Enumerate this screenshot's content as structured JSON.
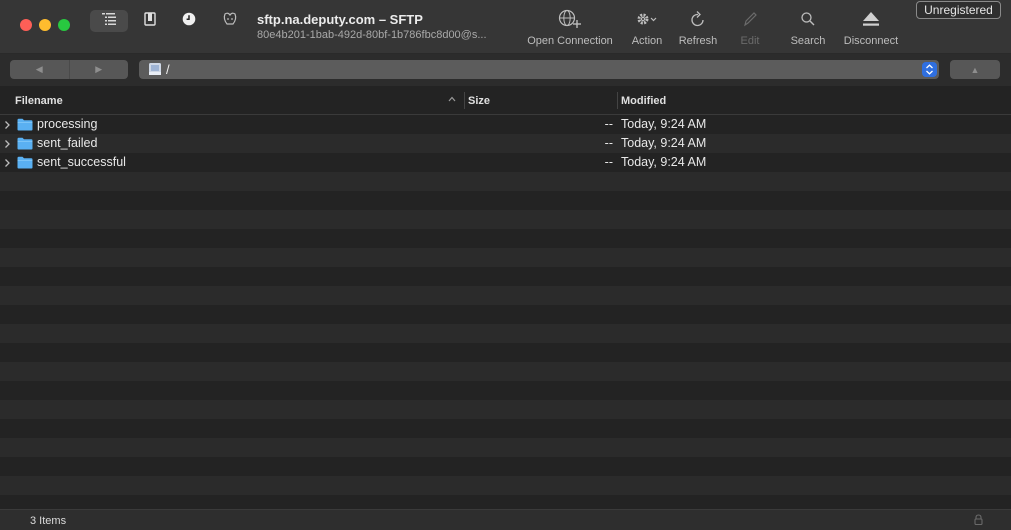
{
  "window": {
    "title": "sftp.na.deputy.com – SFTP",
    "subtitle": "80e4b201-1bab-492d-80bf-1b786fbc8d00@s..."
  },
  "toolbar": {
    "open_connection": "Open Connection",
    "action": "Action",
    "refresh": "Refresh",
    "edit": "Edit",
    "search": "Search",
    "disconnect": "Disconnect"
  },
  "badge": {
    "label": "Unregistered"
  },
  "path": {
    "value": "/"
  },
  "columns": {
    "filename": "Filename",
    "size": "Size",
    "modified": "Modified"
  },
  "files": [
    {
      "name": "processing",
      "size": "--",
      "modified": "Today, 9:24 AM"
    },
    {
      "name": "sent_failed",
      "size": "--",
      "modified": "Today, 9:24 AM"
    },
    {
      "name": "sent_successful",
      "size": "--",
      "modified": "Today, 9:24 AM"
    }
  ],
  "status": {
    "count": "3 Items"
  },
  "colors": {
    "folder": "#5ab0f2",
    "accent": "#2f6fe0",
    "row_alt": "#2b2b2b"
  }
}
